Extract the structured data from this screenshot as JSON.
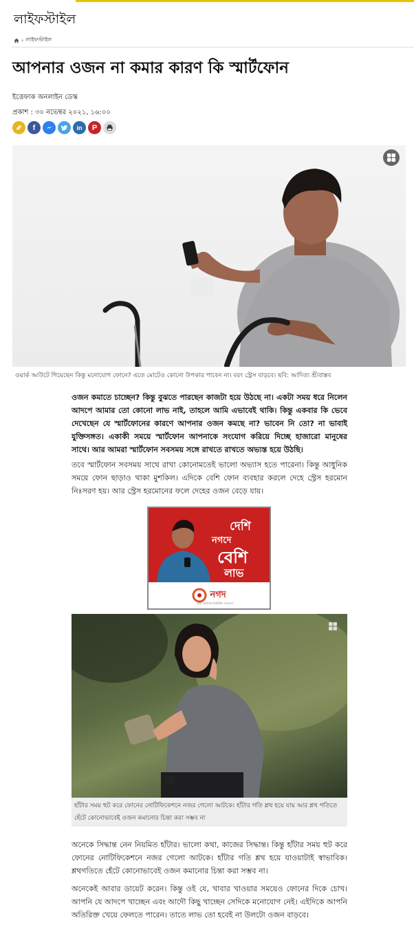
{
  "section": {
    "title": "লাইফস্টাইল"
  },
  "breadcrumb": {
    "home_icon": "home-icon",
    "separator": "›",
    "current": "লাইফস্টাইল"
  },
  "article": {
    "headline": "আপনার ওজন না কমার কারণ কি স্মার্টফোন",
    "byline": "ইত্তেফাক অনলাইন ডেস্ক",
    "published": "প্রকাশ : ৩০ নভেম্বর ২০২১, ১৬:০০",
    "share_buttons": [
      {
        "icon": "link-icon",
        "color": "#e8b422"
      },
      {
        "icon": "facebook-icon",
        "color": "#3b5998"
      },
      {
        "icon": "messenger-icon",
        "color": "#2f80ed"
      },
      {
        "icon": "twitter-icon",
        "color": "#4ba3e8"
      },
      {
        "icon": "linkedin-icon",
        "color": "#2f6ba8"
      },
      {
        "icon": "pinterest-icon",
        "color": "#c8232c"
      },
      {
        "icon": "print-icon",
        "color": "#dddddd"
      }
    ],
    "hero_caption": "ওয়ার্ক আউটে গিয়েছেন কিন্তু মনোযোগ ফোনে? এতে মোটেও কোনো উপকার পাবেন না। বরং স্ট্রেস বাড়বে।  ছবি: আদিত্য শ্রীবাস্তব",
    "lead": "ওজন কমাতে চাচ্ছেন? কিন্তু বুঝতে পারছেন কাজটা হয়ে উঠছে না। একটা সময় ধরে নিলেন আদপে আমার তো কোনো লাভ নাই, তাহলে আমি এভাবেই থাকি। কিন্তু একবার কি ভেবে দেখেছেন যে স্মার্টফোনের কারণে আপনার ওজন কমছে না? ভাবেন নি তো? না ভাবাই যুক্তিসঙ্গত। একাকী সময়ে স্মার্টফোন আপনাকে সংযোগ করিয়ে দিচ্ছে হাজারো মানুষের সাথে। আর আমরা স্মার্টফোন সবসময় সঙ্গে রাখতে রাখতে অভ্যস্ত হয়ে উঠছি।",
    "para1": "তবে স্মার্টফোন সবসময় সাথে রাখা কোনোমতেই ভালো অভ্যাস হতে পারেনা। কিন্তু আধুনিক সময়ে ফোন ছাড়াও থাকা মুশকিল। এদিকে বেশি ফোন ব্যবহার করলে দেহে স্ট্রেস হরমোন নিঃসরণ হয়। আর স্ট্রেস হরমোনের ফলে দেহের ওজন বেড়ে যায়।",
    "photo2_caption": "হাঁটার সময় হুট করে ফোনের নোটিফিকেশনে নজর গেলো আটকে। হাঁটার গতি শ্লথ হয়ে যায় আর শ্লথ গতিতে হেঁটে কোনোভাবেই ওজন কমানোর চিন্তা করা সম্ভব না",
    "para2": "অনেকে সিদ্ধান্ত নেন নিয়মিত হাঁটার। ভালো কথা, কাজের সিদ্ধান্ত। কিন্তু হাঁটার সময় হুট করে ফোনের নোটিফিকেশনে নজর গেলো আটকে। হাঁটার গতি শ্লথ হয়ে যাওয়াটাই স্বাভাবিক। শ্লথগতিতে হেঁটে কোনোভাবেই ওজন কমানোর চিন্তা করা সম্ভব না।",
    "para3": "অনেকেই আবার ডায়েট করেন। কিন্তু ওই যে, খাবার খাওয়ার সময়েও ফোনের দিকে চোখ। আপনি যে আদপে খাচ্ছেন এবং আদৌ কিছু খাচ্ছেন সেদিকে মনোযোগ নেই। এইদিকে আপনি অতিরিক্ত খেয়ে ফেলতে পারেন। তাতে লাভ তো হবেই না উলটো ওজন বাড়বে।"
  },
  "ad": {
    "line1": "দেশি",
    "line2": "নগদে",
    "line3": "বেশি",
    "line4": "লাভ",
    "brand": "নগদ",
    "brand_sub": "ডাক বিভাগের ডিজিটাল লেনদেন",
    "color": "#c8211f"
  }
}
